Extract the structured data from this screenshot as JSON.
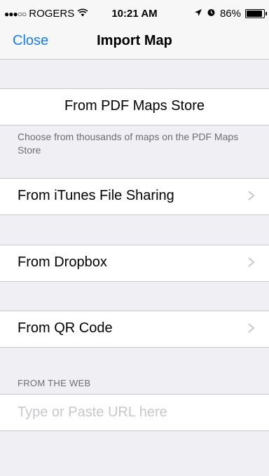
{
  "status_bar": {
    "signal": "●●●○○",
    "carrier": "ROGERS",
    "wifi_icon": "wifi-icon",
    "time": "10:21 AM",
    "battery_percent": "86%",
    "battery_level": 0.86
  },
  "nav": {
    "close_label": "Close",
    "title": "Import Map"
  },
  "rows": {
    "pdf_store": "From PDF Maps Store",
    "pdf_store_note": "Choose from thousands of maps on the PDF Maps Store",
    "itunes": "From iTunes File Sharing",
    "dropbox": "From Dropbox",
    "qr": "From QR Code"
  },
  "web": {
    "header": "FROM THE WEB",
    "placeholder": "Type or Paste URL here",
    "value": ""
  },
  "colors": {
    "accent": "#1a7cf5",
    "background": "#efeff4",
    "separator": "#c8c7cc",
    "secondary_text": "#6d6d72"
  }
}
